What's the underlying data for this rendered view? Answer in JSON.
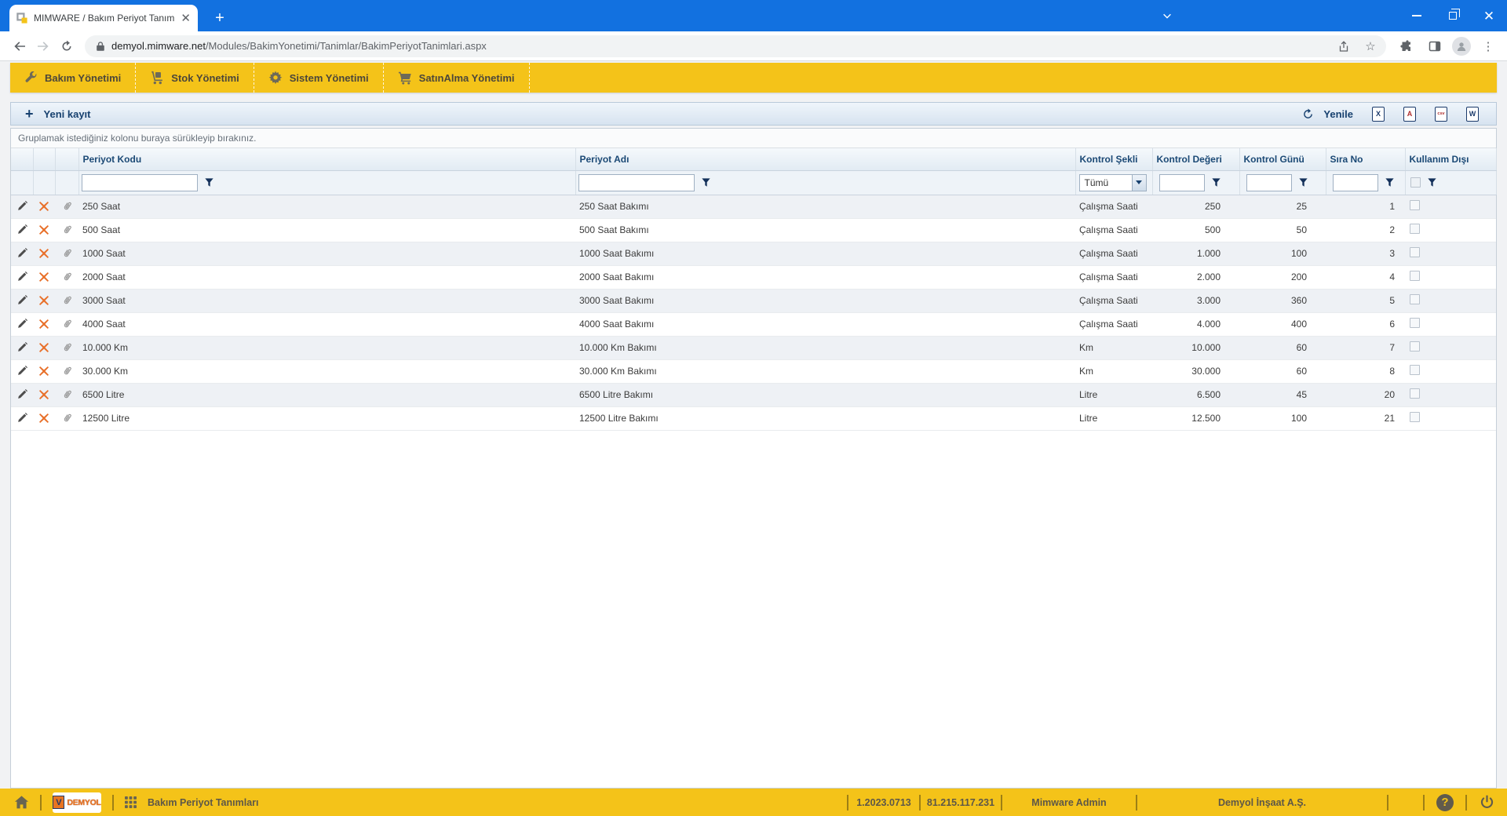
{
  "browser": {
    "tab_title": "MIMWARE / Bakım Periyot Tanım",
    "url": {
      "host": "demyol.mimware.net",
      "path": "/Modules/BakimYonetimi/Tanimlar/BakimPeriyotTanimlari.aspx"
    }
  },
  "menu": {
    "items": [
      {
        "label": "Bakım Yönetimi",
        "icon": "wrench-icon"
      },
      {
        "label": "Stok Yönetimi",
        "icon": "handtruck-icon"
      },
      {
        "label": "Sistem Yönetimi",
        "icon": "gear-icon"
      },
      {
        "label": "SatınAlma Yönetimi",
        "icon": "cart-icon"
      }
    ]
  },
  "toolbar": {
    "new_record_label": "Yeni kayıt",
    "refresh_label": "Yenile",
    "export_icons": [
      {
        "name": "export-xls-icon",
        "glyph": "X"
      },
      {
        "name": "export-pdf-icon",
        "glyph": "A"
      },
      {
        "name": "export-csv-icon",
        "glyph": "csv"
      },
      {
        "name": "export-doc-icon",
        "glyph": "W"
      }
    ]
  },
  "grid": {
    "group_panel_text": "Gruplamak istediğiniz kolonu buraya sürükleyip bırakınız.",
    "columns": {
      "periyot_kodu": "Periyot Kodu",
      "periyot_adi": "Periyot Adı",
      "kontrol_sekli": "Kontrol Şekli",
      "kontrol_degeri": "Kontrol Değeri",
      "kontrol_gunu": "Kontrol Günü",
      "sira_no": "Sıra No",
      "kullanim_disi": "Kullanım Dışı"
    },
    "filters": {
      "kontrol_sekli_selected": "Tümü"
    },
    "rows": [
      {
        "kod": "250 Saat",
        "ad": "250 Saat Bakımı",
        "sekil": "Çalışma Saati",
        "deger": "250",
        "gun": "25",
        "sira": "1",
        "kullanim_disi": false
      },
      {
        "kod": "500 Saat",
        "ad": "500 Saat Bakımı",
        "sekil": "Çalışma Saati",
        "deger": "500",
        "gun": "50",
        "sira": "2",
        "kullanim_disi": false
      },
      {
        "kod": "1000 Saat",
        "ad": "1000 Saat Bakımı",
        "sekil": "Çalışma Saati",
        "deger": "1.000",
        "gun": "100",
        "sira": "3",
        "kullanim_disi": false
      },
      {
        "kod": "2000 Saat",
        "ad": "2000 Saat Bakımı",
        "sekil": "Çalışma Saati",
        "deger": "2.000",
        "gun": "200",
        "sira": "4",
        "kullanim_disi": false
      },
      {
        "kod": "3000 Saat",
        "ad": "3000 Saat Bakımı",
        "sekil": "Çalışma Saati",
        "deger": "3.000",
        "gun": "360",
        "sira": "5",
        "kullanim_disi": false
      },
      {
        "kod": "4000 Saat",
        "ad": "4000 Saat Bakımı",
        "sekil": "Çalışma Saati",
        "deger": "4.000",
        "gun": "400",
        "sira": "6",
        "kullanim_disi": false
      },
      {
        "kod": "10.000 Km",
        "ad": "10.000 Km Bakımı",
        "sekil": "Km",
        "deger": "10.000",
        "gun": "60",
        "sira": "7",
        "kullanim_disi": false
      },
      {
        "kod": "30.000 Km",
        "ad": "30.000 Km Bakımı",
        "sekil": "Km",
        "deger": "30.000",
        "gun": "60",
        "sira": "8",
        "kullanim_disi": false
      },
      {
        "kod": "6500 Litre",
        "ad": "6500 Litre Bakımı",
        "sekil": "Litre",
        "deger": "6.500",
        "gun": "45",
        "sira": "20",
        "kullanim_disi": false
      },
      {
        "kod": "12500 Litre",
        "ad": "12500 Litre Bakımı",
        "sekil": "Litre",
        "deger": "12.500",
        "gun": "100",
        "sira": "21",
        "kullanim_disi": false
      }
    ]
  },
  "statusbar": {
    "page_title": "Bakım Periyot Tanımları",
    "logo_text": "DEMYOL",
    "logo_emblem": "V",
    "version": "1.2023.0713",
    "ip_address": "81.215.117.231",
    "user_name": "Mimware Admin",
    "company_name": "Demyol İnşaat A.Ş.",
    "help_glyph": "?"
  },
  "colors": {
    "accent_yellow": "#f4c319",
    "titlebar_blue": "#1271e0",
    "header_navy": "#1b4975",
    "toolbar_navy": "#17416f",
    "delete_orange": "#e8702a",
    "row_alt": "#eef1f5"
  }
}
